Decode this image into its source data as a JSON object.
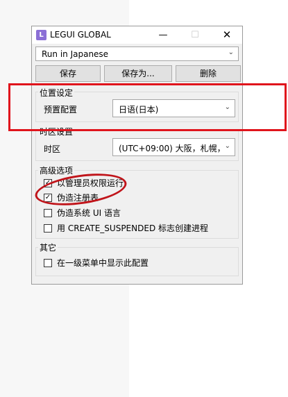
{
  "window": {
    "icon_letter": "L",
    "title": "LEGUI GLOBAL",
    "minimize_glyph": "—",
    "maximize_glyph": "☐",
    "close_glyph": "✕"
  },
  "profile": {
    "selected": "Run in Japanese"
  },
  "buttons": {
    "save": "保存",
    "save_as": "保存为...",
    "delete": "删除"
  },
  "location": {
    "group_label": "位置设定",
    "field_label": "预置配置",
    "selected": "日语(日本)"
  },
  "timezone": {
    "group_label": "时区设置",
    "field_label": "时区",
    "selected": "(UTC+09:00) 大阪，札幌，东京"
  },
  "advanced": {
    "group_label": "高级选项",
    "options": [
      {
        "label": "以管理员权限运行",
        "checked": true
      },
      {
        "label": "伪造注册表",
        "checked": true
      },
      {
        "label": "伪造系统 UI 语言",
        "checked": false
      },
      {
        "label": "用 CREATE_SUSPENDED 标志创建进程",
        "checked": false
      }
    ]
  },
  "other": {
    "group_label": "其它",
    "options": [
      {
        "label": "在一级菜单中显示此配置",
        "checked": false
      }
    ]
  },
  "colors": {
    "annotation_red": "#e0141c",
    "app_icon": "#8b6fd6"
  }
}
